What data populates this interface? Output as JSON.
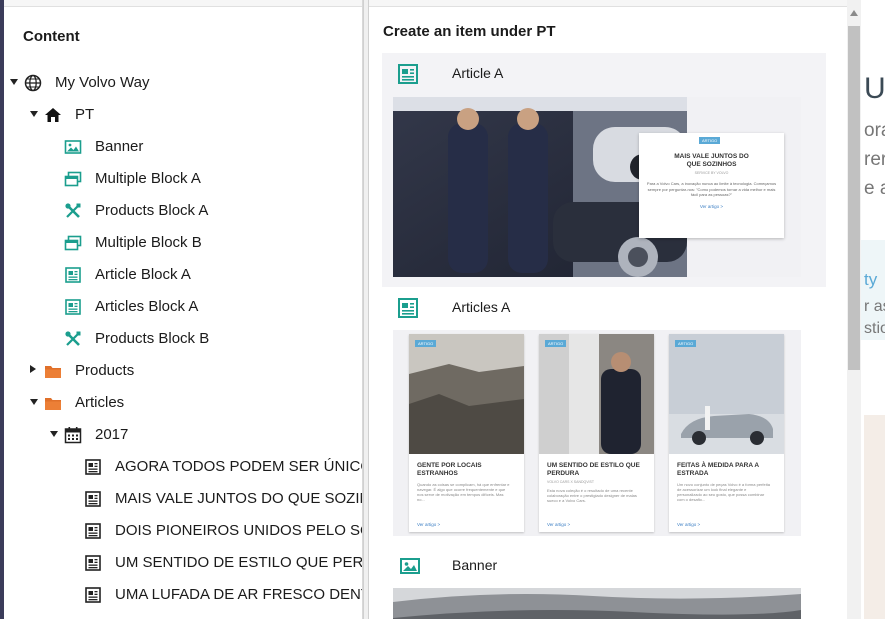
{
  "left_panel": {
    "heading": "Content",
    "tree": [
      {
        "label": "My Volvo Way",
        "icon": "globe-icon",
        "caret": "down",
        "depth": 0
      },
      {
        "label": "PT",
        "icon": "home-icon",
        "caret": "down",
        "depth": 1
      },
      {
        "label": "Banner",
        "icon": "image-icon",
        "caret": "none",
        "depth": 2
      },
      {
        "label": "Multiple Block A",
        "icon": "multi-block-icon",
        "caret": "none",
        "depth": 2
      },
      {
        "label": "Products Block A",
        "icon": "tools-icon",
        "caret": "none",
        "depth": 2
      },
      {
        "label": "Multiple Block B",
        "icon": "multi-block-icon",
        "caret": "none",
        "depth": 2
      },
      {
        "label": "Article Block A",
        "icon": "article-icon",
        "caret": "none",
        "depth": 2
      },
      {
        "label": "Articles Block A",
        "icon": "article-icon",
        "caret": "none",
        "depth": 2
      },
      {
        "label": "Products Block B",
        "icon": "tools-icon",
        "caret": "none",
        "depth": 2
      },
      {
        "label": "Products",
        "icon": "folder-icon",
        "caret": "right",
        "depth": 1
      },
      {
        "label": "Articles",
        "icon": "folder-icon",
        "caret": "down",
        "depth": 1
      },
      {
        "label": "2017",
        "icon": "calendar-icon",
        "caret": "down",
        "depth": 2
      },
      {
        "label": "AGORA TODOS PODEM SER ÚNICOS",
        "icon": "news-icon",
        "caret": "none",
        "depth": 3
      },
      {
        "label": "MAIS VALE JUNTOS DO QUE SOZINHOS",
        "icon": "news-icon",
        "caret": "none",
        "depth": 3
      },
      {
        "label": "DOIS PIONEIROS UNIDOS PELO SOM",
        "icon": "news-icon",
        "caret": "none",
        "depth": 3
      },
      {
        "label": "UM SENTIDO DE ESTILO QUE PERDURA",
        "icon": "news-icon",
        "caret": "none",
        "depth": 3
      },
      {
        "label": "UMA LUFADA DE AR FRESCO DENTRO",
        "icon": "news-icon",
        "caret": "none",
        "depth": 3
      }
    ]
  },
  "dialog": {
    "title": "Create an item under PT",
    "items": [
      {
        "label": "Article A",
        "icon": "article-icon",
        "selected": true,
        "card": {
          "tag": "ARTIGO",
          "title": "MAIS VALE JUNTOS DO QUE SOZINHOS",
          "subtitle": "SERVICE BY VOLVO",
          "body": "Para a Volvo Cars, a inovação nunca ao limite à tecnologia. Começamos sempre por perguntar-nos: \"Como podemos tornar a vida melhor e mais fácil para as pessoas?\"",
          "link": "Ver artigo >"
        }
      },
      {
        "label": "Articles A",
        "icon": "article-icon",
        "selected": false,
        "cards": [
          {
            "tag": "ARTIGO",
            "title": "GENTE POR LOCAIS ESTRANHOS",
            "subtitle": "",
            "body": "Quando as coisas se complicam, há que enfrentar e navegar. É algo que ocorre frequentemente e que nos serve de motivação em tempos difíceis. Mas no...",
            "link": "Ver artigo >"
          },
          {
            "tag": "ARTIGO",
            "title": "UM SENTIDO DE ESTILO QUE PERDURA",
            "subtitle": "VOLVO CARS X SANDQVIST",
            "body": "Esta nova coleção é o resultado de uma recente colaboração entre o prestigiado designer de malas sueco e a Volvo Cars.",
            "link": "Ver artigo >"
          },
          {
            "tag": "ARTIGO",
            "title": "FEITAS À MEDIDA PARA A ESTRADA",
            "subtitle": "",
            "body": "Um novo conjunto de peças Volvo é a forma perfeita de acessorizar um look final elegante e personalizado ao seu gosto, que possa combinar com o desafio...",
            "link": "Ver artigo >"
          }
        ]
      },
      {
        "label": "Banner",
        "icon": "image-icon",
        "selected": false
      }
    ]
  },
  "background_page": {
    "fragments": [
      "U",
      "ora",
      "rerv",
      "e a",
      "ty",
      "r as",
      "stio"
    ]
  },
  "colors": {
    "teal_icon": "#1b9e8e",
    "folder": "#e0702a",
    "tag": "#5aa9d6",
    "link": "#3c7fc4",
    "sidebar_edge": "#3b3c5a"
  }
}
